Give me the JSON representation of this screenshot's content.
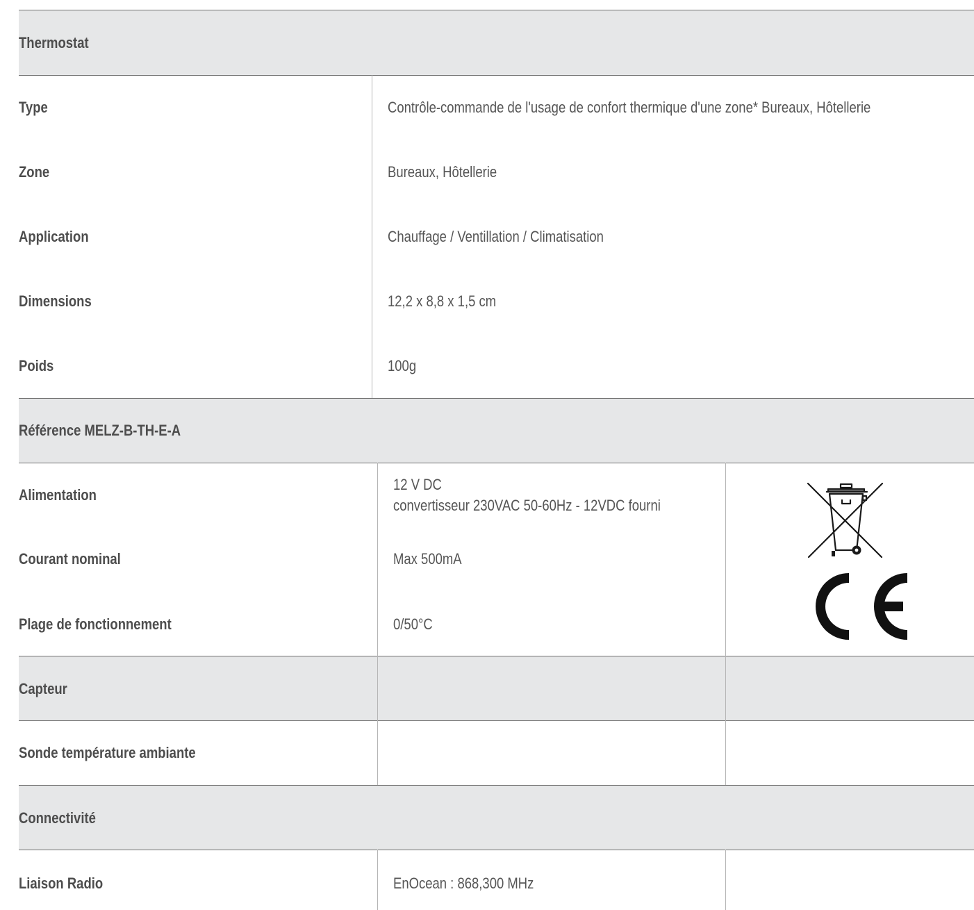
{
  "sections": [
    {
      "title": "Thermostat",
      "rows": [
        {
          "label": "Type",
          "value": "Contrôle-commande de l'usage de confort thermique d'une zone* Bureaux, Hôtellerie"
        },
        {
          "label": "Zone",
          "value": "Bureaux, Hôtellerie"
        },
        {
          "label": "Application",
          "value": "Chauffage / Ventillation / Climatisation"
        },
        {
          "label": "Dimensions",
          "value": "12,2 x 8,8 x 1,5 cm"
        },
        {
          "label": "Poids",
          "value": "100g"
        }
      ]
    },
    {
      "title": "Référence MELZ-B-TH-E-A",
      "rows": [
        {
          "label": "Alimentation",
          "value_line1": "12 V DC",
          "value_line2": "convertisseur 230VAC 50-60Hz - 12VDC fourni"
        },
        {
          "label": "Courant nominal",
          "value": "Max 500mA"
        },
        {
          "label": "Plage de fonctionnement",
          "value": "0/50°C"
        }
      ],
      "icons": [
        "weee-crossed-bin-icon",
        "ce-mark-icon"
      ]
    },
    {
      "title": "Capteur",
      "rows": [
        {
          "label": "Sonde température ambiante",
          "value": ""
        }
      ]
    },
    {
      "title": "Connectivité",
      "rows": [
        {
          "label": "Liaison Radio",
          "value": "EnOcean : 868,300 MHz"
        }
      ]
    }
  ],
  "colors": {
    "header_band": "#e6e7e8",
    "rule": "#6f6f6f",
    "text": "#4a4a4a"
  }
}
